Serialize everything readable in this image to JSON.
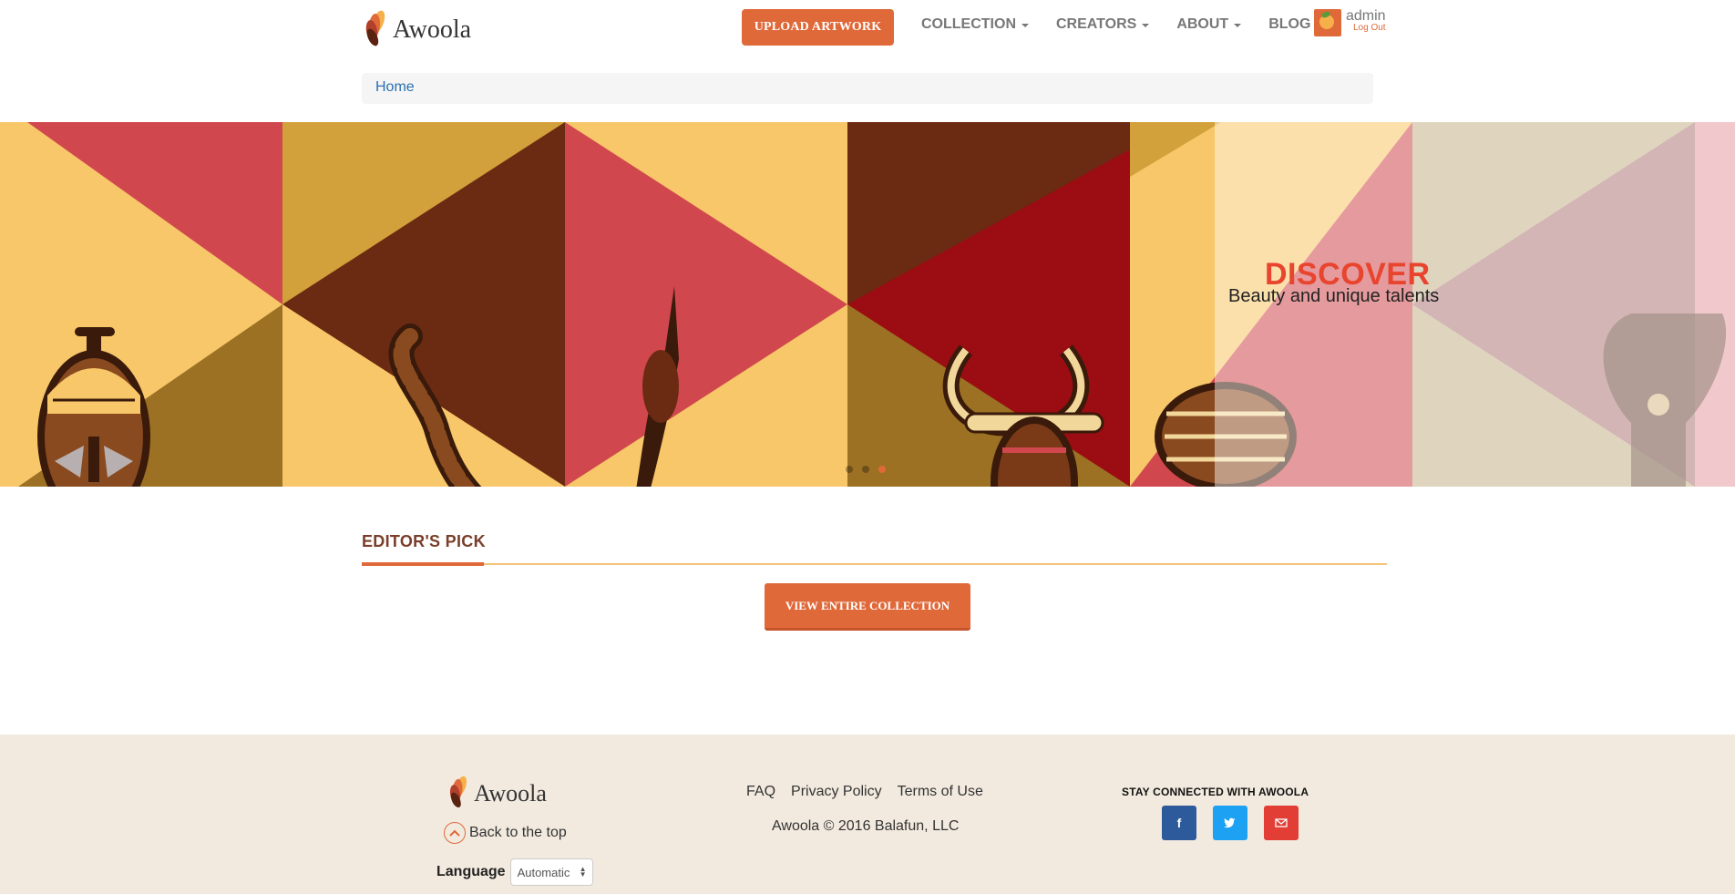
{
  "brand": {
    "name": "Awoola"
  },
  "nav": {
    "upload_label": "UPLOAD ARTWORK",
    "items": [
      {
        "label": "COLLECTION",
        "dropdown": true
      },
      {
        "label": "CREATORS",
        "dropdown": true
      },
      {
        "label": "ABOUT",
        "dropdown": true
      },
      {
        "label": "BLOG",
        "dropdown": false
      }
    ],
    "user": {
      "name": "admin",
      "logout_label": "Log Out"
    }
  },
  "breadcrumb": {
    "items": [
      "Home"
    ]
  },
  "hero": {
    "title": "DISCOVER",
    "subtitle": "Beauty and unique talents",
    "slides_count": 3,
    "active_slide": 3
  },
  "editors_pick": {
    "title": "EDITOR'S PICK",
    "button_label": "VIEW ENTIRE COLLECTION"
  },
  "footer": {
    "brand": "Awoola",
    "back_to_top": "Back to the top",
    "language_label": "Language",
    "language_value": "Automatic",
    "links": [
      "FAQ",
      "Privacy Policy",
      "Terms of Use"
    ],
    "copyright": "Awoola © 2016 Balafun, LLC",
    "stay_connected": "STAY CONNECTED WITH AWOOLA",
    "social": [
      "facebook-icon",
      "twitter-icon",
      "mail-icon"
    ]
  },
  "colors": {
    "accent": "#e0693a",
    "hero_red": "#d0474e",
    "hero_yellow": "#f7c769",
    "hero_brown": "#6b2a12",
    "footer_bg": "#f2eadf"
  }
}
